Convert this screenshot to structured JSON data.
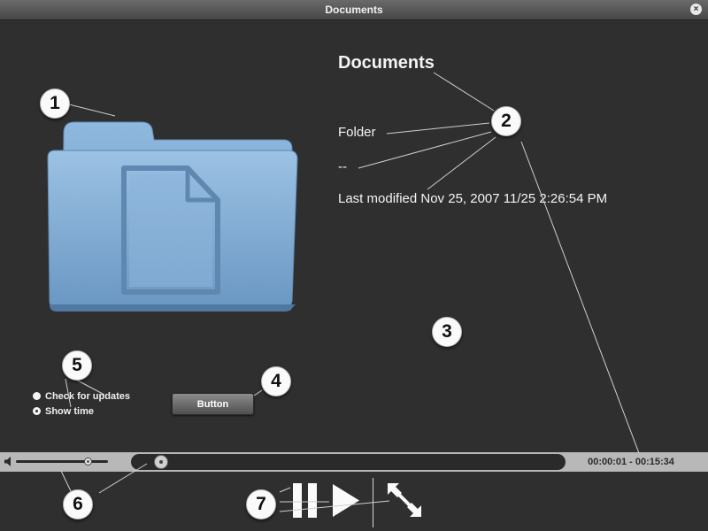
{
  "window": {
    "title": "Documents",
    "close_symbol": "×"
  },
  "folder": {
    "icon": "folder-document-icon"
  },
  "info": {
    "name": "Documents",
    "kind": "Folder",
    "size": "--",
    "modified": "Last modified Nov 25, 2007 11/25 2:26:54 PM"
  },
  "options": {
    "check_updates_label": "Check for updates",
    "show_time_label": "Show time",
    "selected": "Show time"
  },
  "button": {
    "label": "Button"
  },
  "playback": {
    "volume_level": 0.78,
    "progress_fraction": 0.07,
    "time": "00:00:01 - 00:15:34"
  },
  "callouts": [
    "1",
    "2",
    "3",
    "4",
    "5",
    "6",
    "7"
  ],
  "colors": {
    "background": "#2f2f2f",
    "titlebar": "#555555",
    "scrubber_bar": "#b8b8b8",
    "folder_blue": "#7fa9d1",
    "text": "#f4f4f4"
  }
}
